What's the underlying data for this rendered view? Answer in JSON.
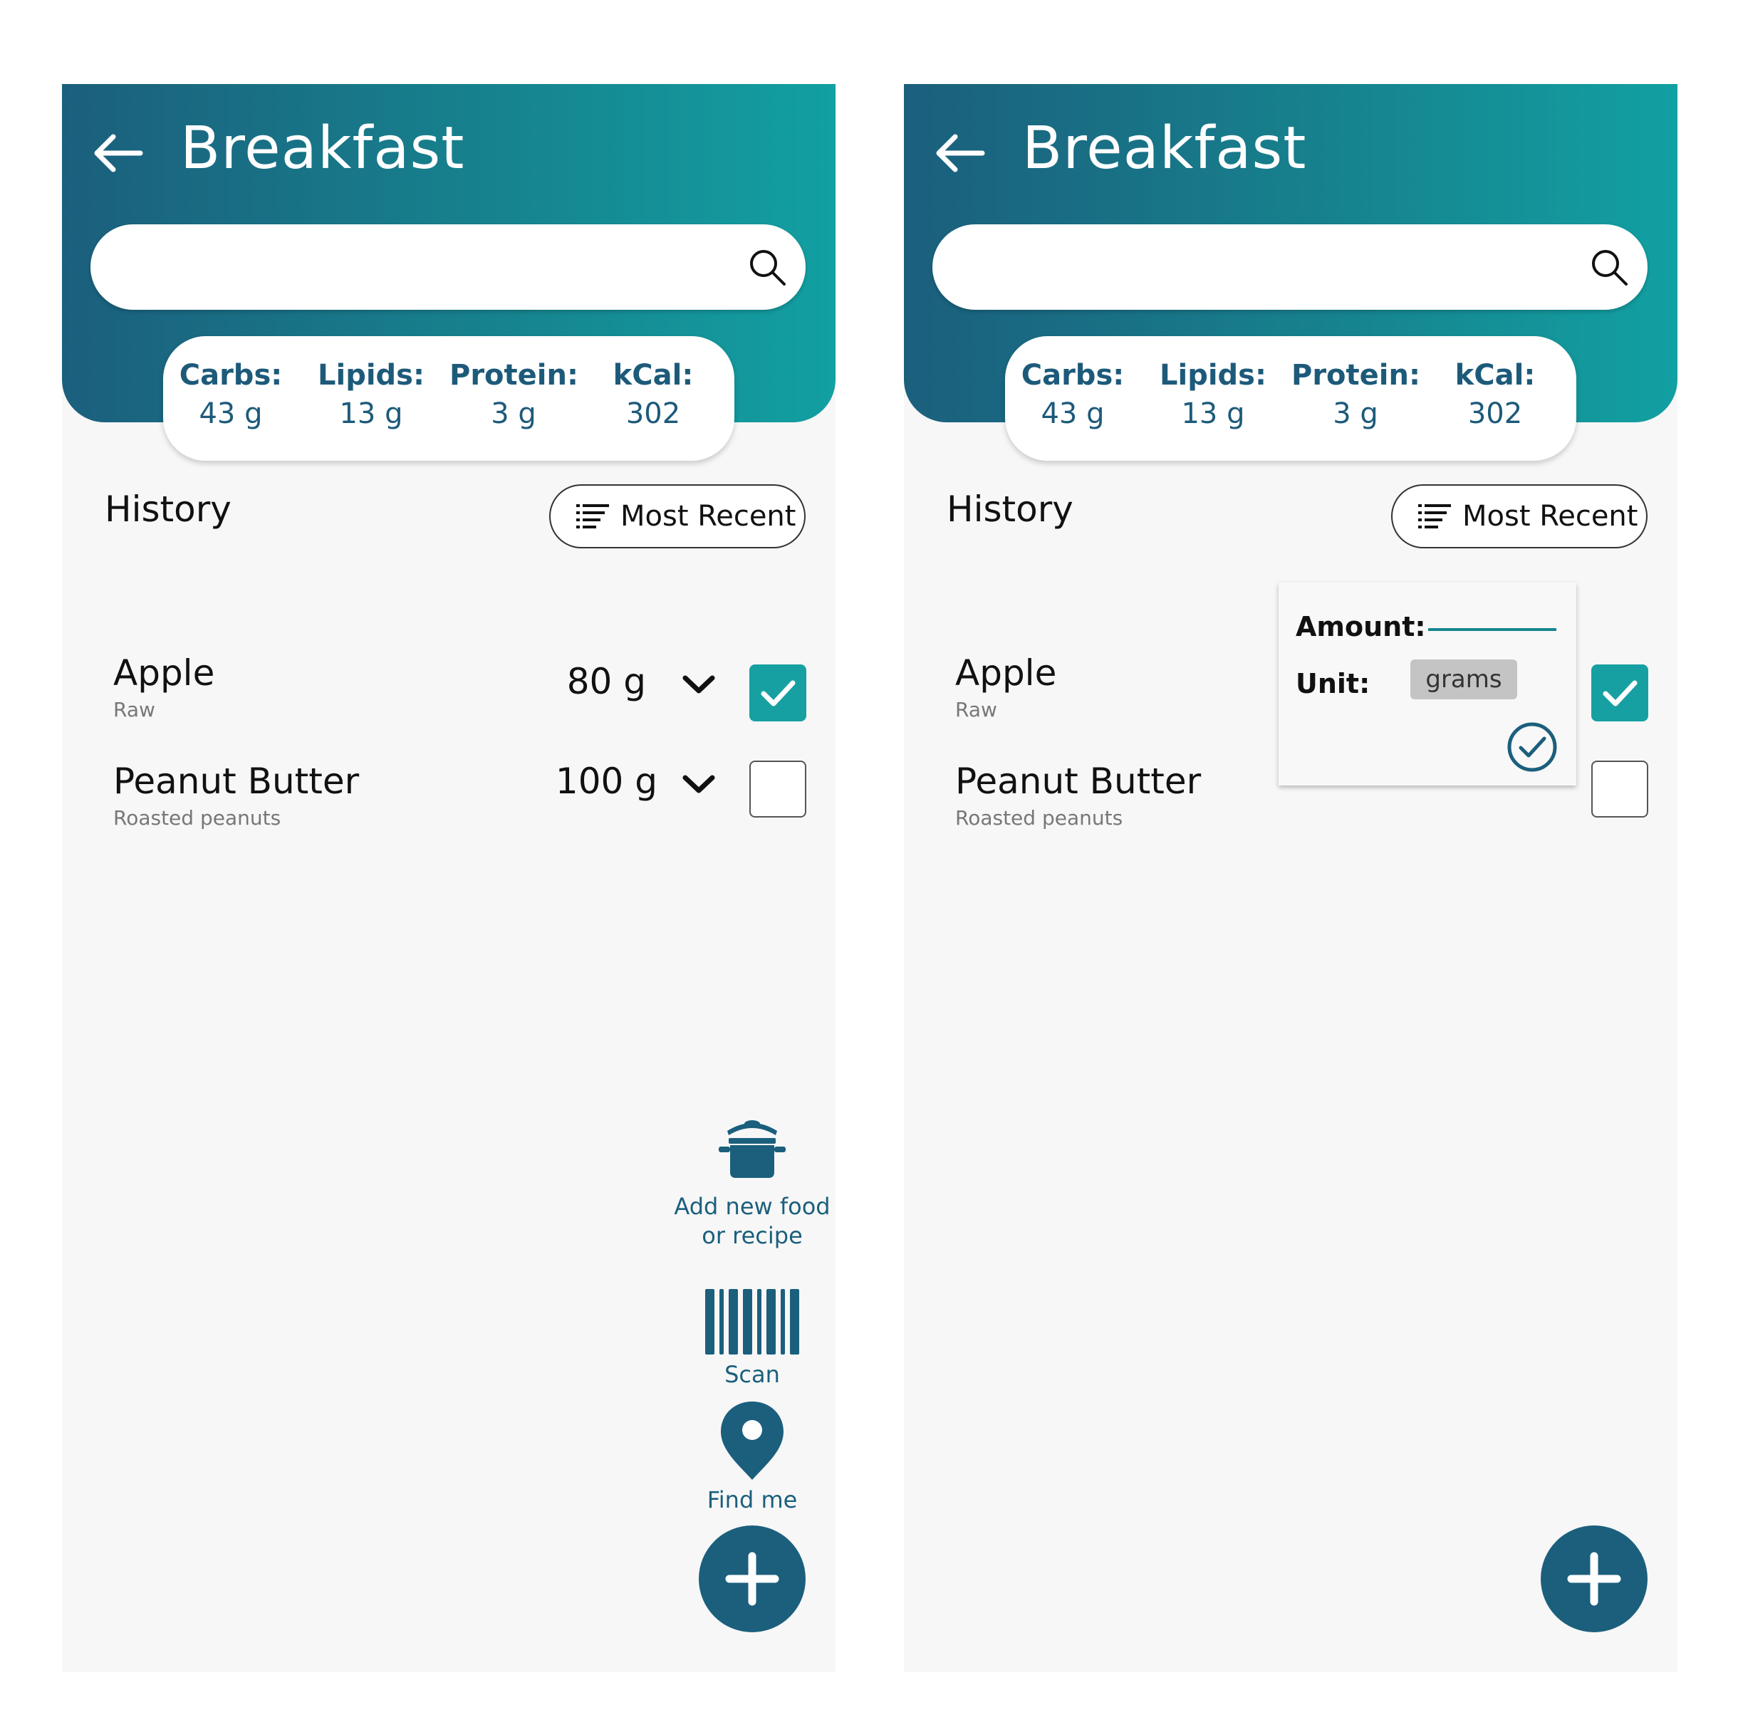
{
  "screens": [
    {
      "title": "Breakfast",
      "search": {
        "value": "",
        "placeholder": ""
      },
      "macros": [
        {
          "label": "Carbs:",
          "value": "43 g"
        },
        {
          "label": "Lipids:",
          "value": "13 g"
        },
        {
          "label": "Protein:",
          "value": "3 g"
        },
        {
          "label": "kCal:",
          "value": "302"
        }
      ],
      "history_title": "History",
      "sort_label": "Most Recent",
      "items": [
        {
          "name": "Apple",
          "sub": "Raw",
          "qty": "80 g",
          "checked": true
        },
        {
          "name": "Peanut Butter",
          "sub": "Roasted peanuts",
          "qty": "100 g",
          "checked": false
        }
      ],
      "actions": {
        "add_food": "Add new food or recipe",
        "scan": "Scan",
        "find_me": "Find me"
      }
    },
    {
      "title": "Breakfast",
      "search": {
        "value": "",
        "placeholder": ""
      },
      "macros": [
        {
          "label": "Carbs:",
          "value": "43 g"
        },
        {
          "label": "Lipids:",
          "value": "13 g"
        },
        {
          "label": "Protein:",
          "value": "3 g"
        },
        {
          "label": "kCal:",
          "value": "302"
        }
      ],
      "history_title": "History",
      "sort_label": "Most Recent",
      "items": [
        {
          "name": "Apple",
          "sub": "Raw",
          "checked": true
        },
        {
          "name": "Peanut Butter",
          "sub": "Roasted peanuts",
          "checked": false
        }
      ],
      "popup": {
        "amount_label": "Amount:",
        "amount_value": "",
        "unit_label": "Unit:",
        "unit_value": "grams"
      }
    }
  ],
  "icons": {
    "back": "arrow-left-icon",
    "search": "magnifier-icon",
    "sort": "sort-lines-icon",
    "chevron": "chevron-down-icon",
    "check": "checkmark-icon",
    "add_food": "cooking-pot-icon",
    "scan": "barcode-icon",
    "find_me": "map-pin-icon",
    "fab": "plus-icon",
    "confirm": "circle-check-icon"
  },
  "colors": {
    "header_start": "#1b5f7d",
    "header_end": "#12a0a2",
    "accent": "#17a0a2",
    "dark_teal": "#1b5f7d",
    "background": "#f7f7f7"
  }
}
